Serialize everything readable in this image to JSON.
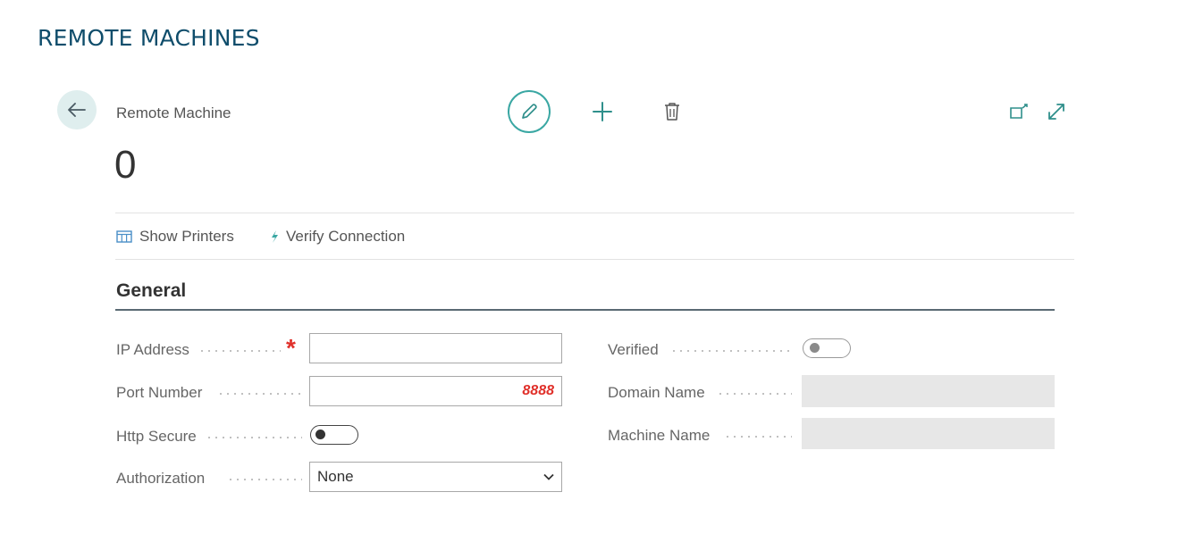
{
  "page": {
    "heading": "REMOTE MACHINES"
  },
  "header": {
    "entity_type": "Remote Machine",
    "record_title": "0"
  },
  "actions": {
    "show_printers": "Show Printers",
    "verify_connection": "Verify Connection"
  },
  "section": {
    "title": "General"
  },
  "fields": {
    "ip_address": {
      "label": "IP Address",
      "value": "",
      "required": true
    },
    "port_number": {
      "label": "Port Number",
      "value": "8888"
    },
    "http_secure": {
      "label": "Http Secure",
      "value": false
    },
    "authorization": {
      "label": "Authorization",
      "value": "None"
    },
    "verified": {
      "label": "Verified",
      "value": false
    },
    "domain_name": {
      "label": "Domain Name",
      "value": ""
    },
    "machine_name": {
      "label": "Machine Name",
      "value": ""
    }
  },
  "icons": {
    "back": "arrow-left-icon",
    "edit": "pencil-icon",
    "new": "plus-icon",
    "delete": "trash-icon",
    "popout": "open-in-new-window-icon",
    "expand": "expand-icon",
    "show_printers": "table-icon",
    "verify_connection": "lightning-icon",
    "dropdown": "chevron-down-icon"
  },
  "colors": {
    "heading": "#0f4d6b",
    "accent": "#3aa7a3",
    "required": "#e0312b",
    "port_value": "#e0312b"
  }
}
